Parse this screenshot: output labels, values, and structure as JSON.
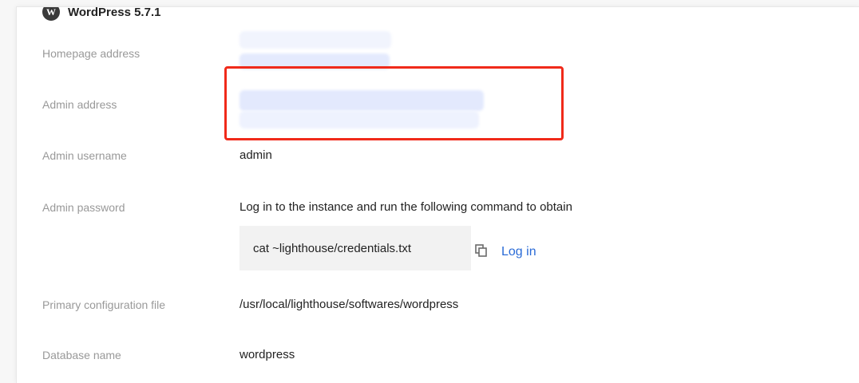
{
  "header": {
    "title": "WordPress 5.7.1"
  },
  "rows": {
    "homepage": {
      "label": "Homepage address"
    },
    "admin_address": {
      "label": "Admin address"
    },
    "admin_username": {
      "label": "Admin username",
      "value": "admin"
    },
    "admin_password": {
      "label": "Admin password",
      "value": "Log in to the instance and run the following command to obtain",
      "command": "cat ~lighthouse/credentials.txt",
      "copy_icon": "copy-icon",
      "login_label": "Log in"
    },
    "config_file": {
      "label": "Primary configuration file",
      "value": "/usr/local/lighthouse/softwares/wordpress"
    },
    "database": {
      "label": "Database name",
      "value": "wordpress"
    }
  },
  "colors": {
    "highlight": "#f02a1a",
    "link": "#2a6bd7",
    "label": "#999999"
  }
}
